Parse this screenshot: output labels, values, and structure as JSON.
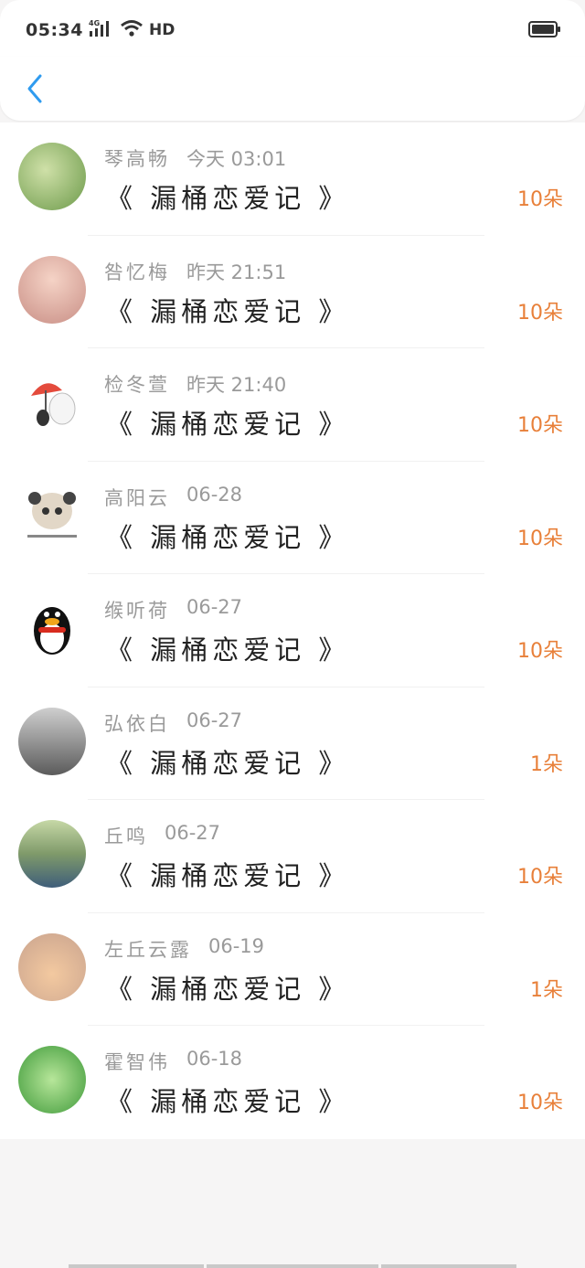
{
  "status_bar": {
    "time": "05:34",
    "network": "HD"
  },
  "header": {},
  "gifts": [
    {
      "name": "琴高畅",
      "time": "今天 03:01",
      "book": "《 漏桶恋爱记 》",
      "count": "10朵",
      "avatar_color": "#8fb86a"
    },
    {
      "name": "咎忆梅",
      "time": "昨天 21:51",
      "book": "《 漏桶恋爱记 》",
      "count": "10朵",
      "avatar_color": "#e8b7b1"
    },
    {
      "name": "检冬萱",
      "time": "昨天 21:40",
      "book": "《 漏桶恋爱记 》",
      "count": "10朵",
      "avatar_color": "#f4f1ea"
    },
    {
      "name": "高阳云",
      "time": "06-28",
      "book": "《 漏桶恋爱记 》",
      "count": "10朵",
      "avatar_color": "#e9e4dc"
    },
    {
      "name": "缑听荷",
      "time": "06-27",
      "book": "《 漏桶恋爱记 》",
      "count": "10朵",
      "avatar_color": "#ffffff"
    },
    {
      "name": "弘依白",
      "time": "06-27",
      "book": "《 漏桶恋爱记 》",
      "count": "1朵",
      "avatar_color": "#8b8b8b"
    },
    {
      "name": "丘鸣",
      "time": "06-27",
      "book": "《 漏桶恋爱记 》",
      "count": "10朵",
      "avatar_color": "#6b8f5e"
    },
    {
      "name": "左丘云露",
      "time": "06-19",
      "book": "《 漏桶恋爱记 》",
      "count": "1朵",
      "avatar_color": "#e7b894"
    },
    {
      "name": "霍智伟",
      "time": "06-18",
      "book": "《 漏桶恋爱记 》",
      "count": "10朵",
      "avatar_color": "#63b04f"
    }
  ],
  "colors": {
    "accent": "#2f9bef",
    "count": "#e8803a"
  },
  "icons": {
    "back": "chevron-left-icon",
    "battery": "battery-icon",
    "wifi": "wifi-icon",
    "signal": "signal-icon"
  }
}
